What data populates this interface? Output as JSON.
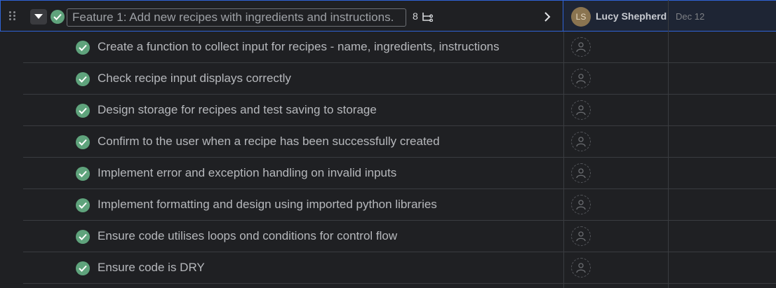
{
  "parent": {
    "title": "Feature 1: Add new recipes with ingredients and instructions.",
    "subtask_count": "8",
    "assignee": {
      "initials": "LS",
      "name": "Lucy Shepherd"
    },
    "due_date": "Dec 12"
  },
  "subtasks": [
    {
      "title": "Create a function to collect input for recipes - name, ingredients, instructions"
    },
    {
      "title": "Check recipe input displays correctly"
    },
    {
      "title": "Design storage for recipes and test saving to storage"
    },
    {
      "title": "Confirm to the user when a recipe has been successfully created"
    },
    {
      "title": "Implement error and exception handling on invalid inputs"
    },
    {
      "title": "Implement formatting and design using imported python libraries"
    },
    {
      "title": "Ensure code utilises loops ond conditions for control flow"
    },
    {
      "title": "Ensure code is DRY"
    }
  ],
  "colors": {
    "accent": "#2f63d6",
    "complete": "#5fa37c",
    "background": "#1f2023"
  },
  "icons": [
    "drag-handle-icon",
    "caret-down-icon",
    "check-circle-icon",
    "subtasks-icon",
    "chevron-right-icon",
    "user-placeholder-icon"
  ]
}
